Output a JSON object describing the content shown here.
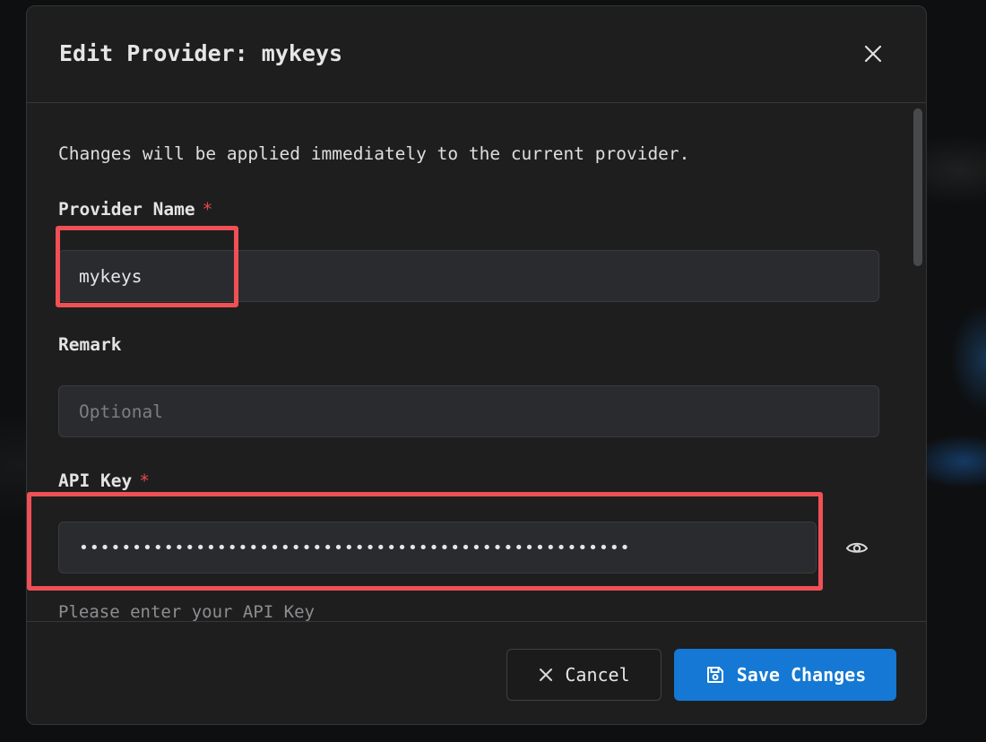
{
  "dialog": {
    "title": "Edit Provider: mykeys",
    "description": "Changes will be applied immediately to the current provider.",
    "provider_name": {
      "label": "Provider Name",
      "required_mark": "*",
      "value": "mykeys"
    },
    "remark": {
      "label": "Remark",
      "placeholder": "Optional",
      "value": ""
    },
    "api_key": {
      "label": "API Key",
      "required_mark": "*",
      "masked_value": "••••••••••••••••••••••••••••••••••••••••••••••••••••",
      "hint": "Please enter your API Key"
    },
    "buttons": {
      "cancel": "Cancel",
      "save": "Save Changes"
    }
  },
  "colors": {
    "accent": "#1478d4",
    "required": "#e5484d",
    "highlight": "#ef5055"
  },
  "icons": [
    "close-icon",
    "eye-icon",
    "x-icon",
    "save-icon"
  ]
}
